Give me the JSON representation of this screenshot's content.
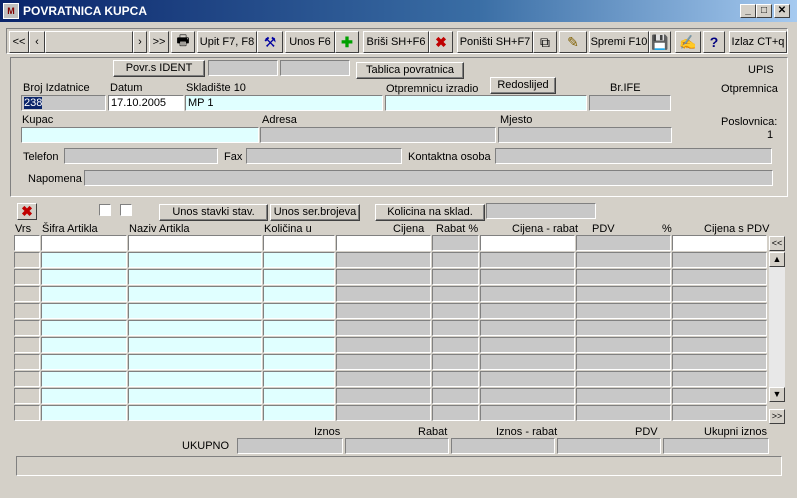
{
  "window": {
    "title": "POVRATNICA KUPCA",
    "app_icon_text": "M"
  },
  "toolbar": {
    "first": "<<",
    "prev": "‹",
    "next": "›",
    "last": ">>",
    "query": "Upit F7, F8",
    "add": "Unos F6",
    "delete": "Briši  SH+F6",
    "cancel": "Poništi SH+F7",
    "save": "Spremi F10",
    "exit": "Izlaz CT+q"
  },
  "header": {
    "btn_ident": "Povr.s IDENT",
    "btn_table": "Tablica povratnica",
    "btn_order": "Redoslijed",
    "mode": "UPIS",
    "doc_type": "Otpremnica",
    "branch_label": "Poslovnica:",
    "branch_value": "1",
    "issue_no_label": "Broj Izdatnice",
    "issue_no_value": "238",
    "date_label": "Datum",
    "date_value": "17.10.2005",
    "warehouse_label": "Skladište 10",
    "warehouse_value": "MP 1",
    "made_by_label": "Otpremnicu izradio",
    "made_by_value": "",
    "ife_label": "Br.IFE",
    "ife_value": "",
    "customer_label": "Kupac",
    "address_label": "Adresa",
    "place_label": "Mjesto",
    "phone_label": "Telefon",
    "fax_label": "Fax",
    "contact_label": "Kontaktna osoba",
    "note_label": "Napomena"
  },
  "items": {
    "btn_entry": "Unos stavki stav.",
    "btn_serial": "Unos ser.brojeva",
    "btn_stock": "Kolicina na sklad.",
    "columns": {
      "vrs": "Vrs",
      "code": "Šifra Artikla",
      "name": "Naziv Artikla",
      "qty": "Količina u",
      "price": "Cijena",
      "discount": "Rabat %",
      "price_minus_discount": "Cijena - rabat",
      "vat": "PDV",
      "pct": "%",
      "price_with_vat": "Cijena s PDV"
    },
    "scroll_up": "<<",
    "scroll_down": ">>"
  },
  "totals": {
    "label": "UKUPNO",
    "amount": "Iznos",
    "discount": "Rabat",
    "amount_minus_discount": "Iznos - rabat",
    "vat": "PDV",
    "total": "Ukupni iznos"
  }
}
